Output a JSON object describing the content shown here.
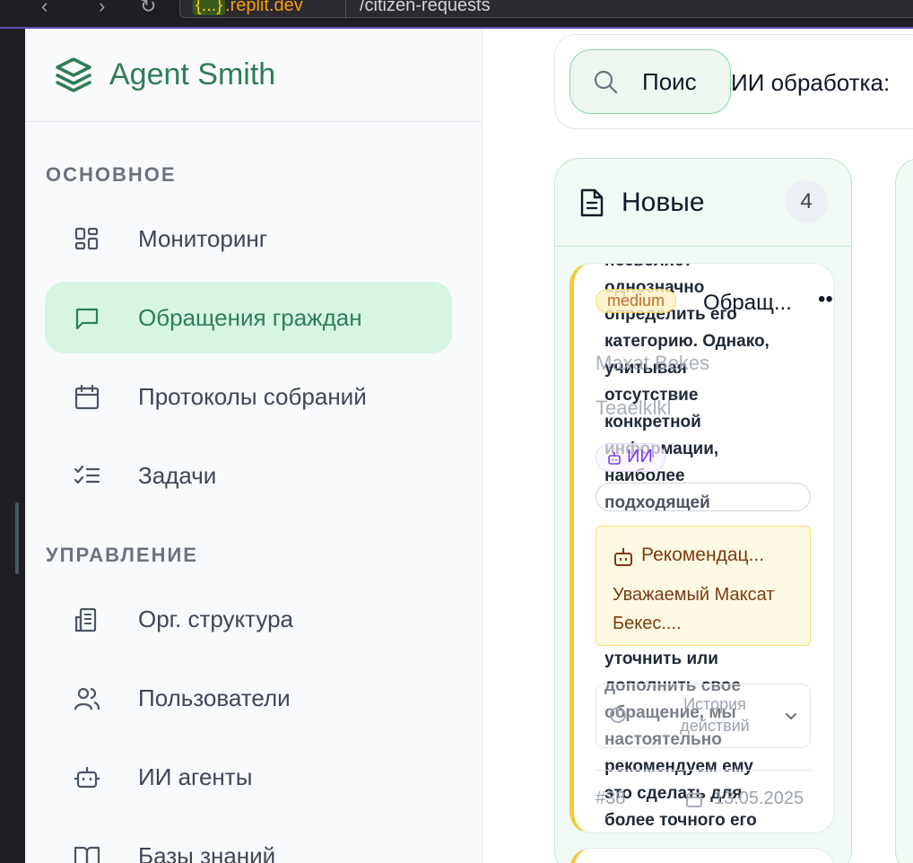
{
  "browser": {
    "host_tag": "{...}",
    "host": ".replit.dev",
    "path": "/citizen-requests"
  },
  "brand": {
    "name": "Agent Smith",
    "color": "#2f7d57"
  },
  "sidebar": {
    "sections": [
      {
        "title": "ОСНОВНОЕ",
        "items": [
          {
            "label": "Мониторинг",
            "icon": "dashboard-icon",
            "active": false
          },
          {
            "label": "Обращения граждан",
            "icon": "message-icon",
            "active": true
          },
          {
            "label": "Протоколы собраний",
            "icon": "calendar-icon",
            "active": false
          },
          {
            "label": "Задачи",
            "icon": "checklist-icon",
            "active": false
          }
        ]
      },
      {
        "title": "УПРАВЛЕНИЕ",
        "items": [
          {
            "label": "Орг. структура",
            "icon": "building-icon",
            "active": false
          },
          {
            "label": "Пользователи",
            "icon": "users-icon",
            "active": false
          },
          {
            "label": "ИИ агенты",
            "icon": "bot-icon",
            "active": false
          },
          {
            "label": "Базы знаний",
            "icon": "book-icon",
            "active": false
          }
        ]
      }
    ]
  },
  "toolbar": {
    "search_text": "Поис",
    "ai_processing_label": "ИИ обработка:"
  },
  "column": {
    "title": "Новые",
    "count": "4"
  },
  "card": {
    "overflow_text": "позволяет\nоднозначно\nопределить его\nкатегорию. Однако,\nучитывая\nотсутствие\nконкретной\nинформации,\nнаиболее\nподходящей",
    "overflow_text_lower": "уточнить или\nдополнить свое\nобращение, мы\nнастоятельно\nрекомендуем ему\nэто сделать для\nболее точного его",
    "priority": "medium",
    "title": "Обращ...",
    "more": "••",
    "author": "Maxat Bekes",
    "subject": "Teaelklkl",
    "ai_badge": "ИИ",
    "recommendation_title": "Рекомендац...",
    "recommendation_body": "Уважаемый Максат Бекес....",
    "history_label": "История действий",
    "id": "#38",
    "date": "13.05.2025"
  },
  "colors": {
    "accent_green": "#2f7d57",
    "active_bg": "#d6f5e3",
    "priority_border": "#f1cc3d"
  }
}
